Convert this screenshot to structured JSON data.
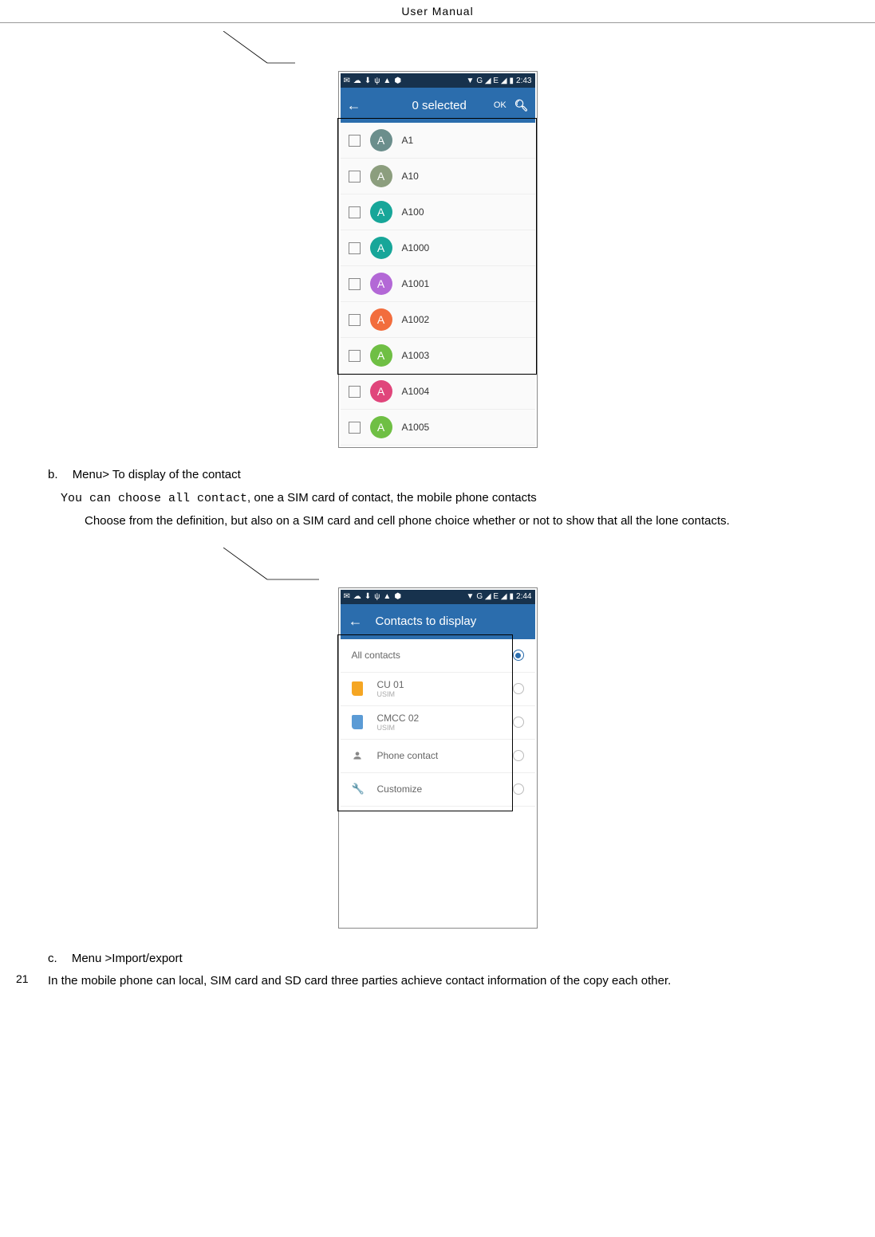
{
  "header": {
    "title": "User    Manual"
  },
  "pageNumber": "21",
  "screenshot1": {
    "statusTime": "2:43",
    "statusSignal": "G ◢ E ◢",
    "appbar": {
      "title": "0 selected",
      "ok": "OK"
    },
    "contacts": [
      {
        "name": "A1",
        "letter": "A",
        "color": "#6b8e8c"
      },
      {
        "name": "A10",
        "letter": "A",
        "color": "#8c9e7e"
      },
      {
        "name": "A100",
        "letter": "A",
        "color": "#17a699"
      },
      {
        "name": "A1000",
        "letter": "A",
        "color": "#17a699"
      },
      {
        "name": "A1001",
        "letter": "A",
        "color": "#b368d6"
      },
      {
        "name": "A1002",
        "letter": "A",
        "color": "#f26d3d"
      },
      {
        "name": "A1003",
        "letter": "A",
        "color": "#6fbf44"
      },
      {
        "name": "A1004",
        "letter": "A",
        "color": "#e0457b"
      },
      {
        "name": "A1005",
        "letter": "A",
        "color": "#6fbf44"
      }
    ]
  },
  "sectionB": {
    "marker": "b.",
    "menuLabel": "Menu>",
    "title": " To display of the contact",
    "line1a": "You can choose all contact",
    "line1b": ", one a SIM card of contact, the mobile phone contacts",
    "line2": "Choose from the definition, but also on a SIM card and cell phone choice whether or not to show that all the lone contacts."
  },
  "screenshot2": {
    "statusTime": "2:44",
    "statusSignal": "G ◢ E ◢",
    "appbar": {
      "title": "Contacts to display"
    },
    "options": [
      {
        "label": "All contacts",
        "sub": "",
        "icon": "none",
        "selected": true
      },
      {
        "label": "CU 01",
        "sub": "USIM",
        "icon": "sim-orange",
        "selected": false
      },
      {
        "label": "CMCC 02",
        "sub": "USIM",
        "icon": "sim-blue",
        "selected": false
      },
      {
        "label": "Phone contact",
        "sub": "",
        "icon": "person",
        "selected": false
      },
      {
        "label": "Customize",
        "sub": "",
        "icon": "wrench",
        "selected": false
      }
    ]
  },
  "sectionC": {
    "marker": "c.",
    "title": "Menu >Import/export",
    "body": "In the mobile phone can local, SIM card and SD card three parties achieve contact information of the copy each other."
  }
}
